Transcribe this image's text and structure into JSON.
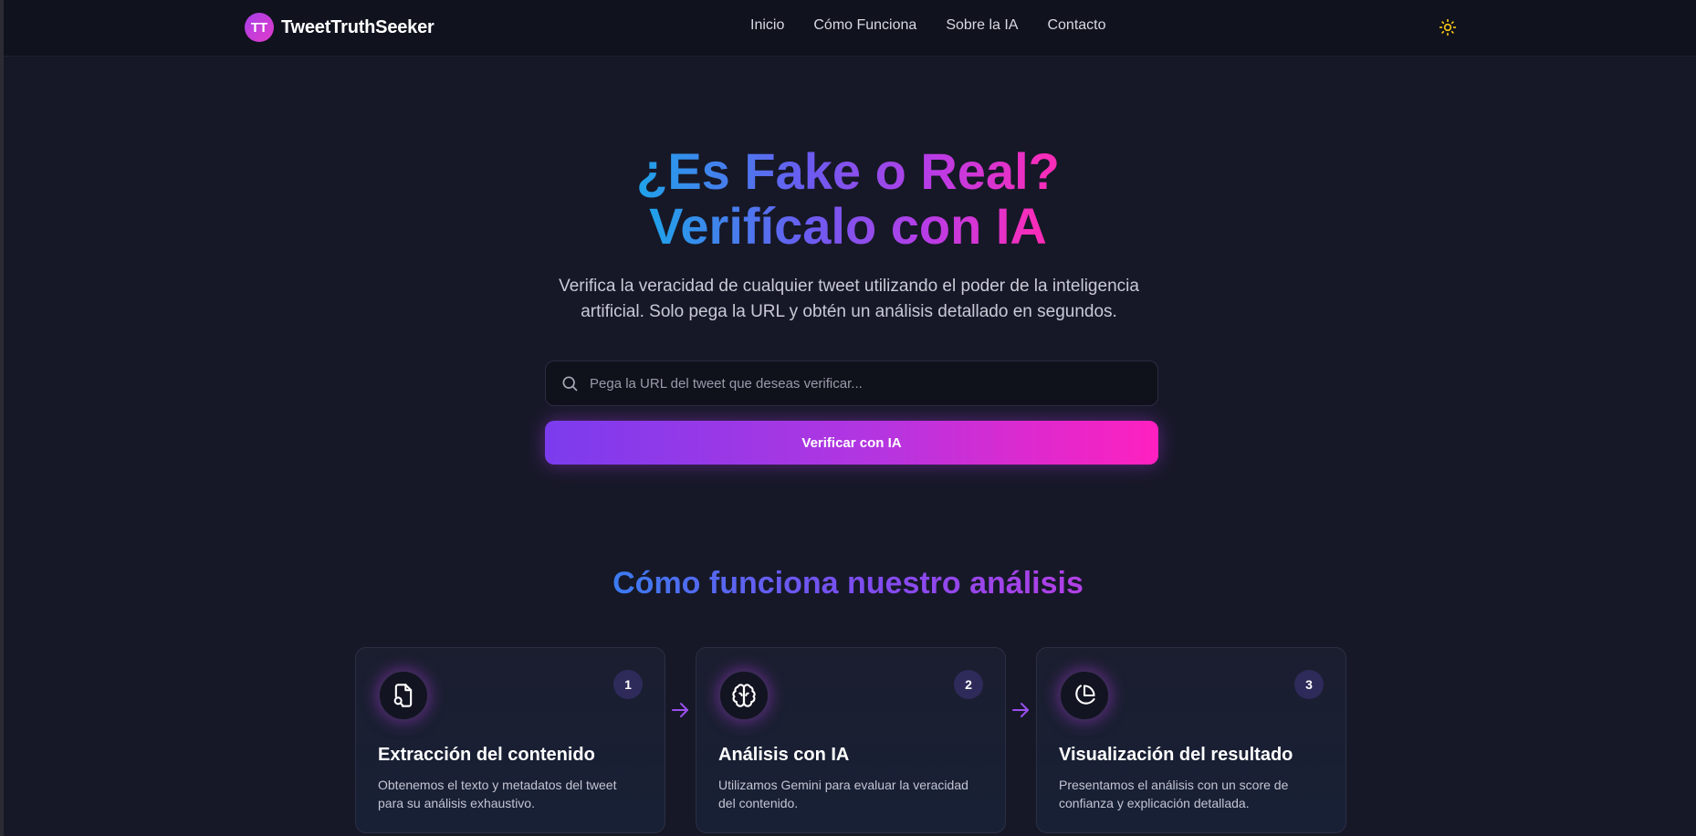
{
  "nav": {
    "logo_initials": "TT",
    "brand": "TweetTruthSeeker",
    "links": [
      "Inicio",
      "Cómo Funciona",
      "Sobre la IA",
      "Contacto"
    ],
    "theme_icon": "sun-icon"
  },
  "hero": {
    "title_line1": "¿Es Fake o Real?",
    "title_line2": "Verifícalo con IA",
    "subtitle": "Verifica la veracidad de cualquier tweet utilizando el poder de la inteligencia artificial. Solo pega la URL y obtén un análisis detallado en segundos.",
    "search_placeholder": "Pega la URL del tweet que deseas verificar...",
    "search_value": "",
    "button_label": "Verificar con IA"
  },
  "how": {
    "title": "Cómo funciona nuestro análisis",
    "steps": [
      {
        "number": "1",
        "icon": "file-search-icon",
        "title": "Extracción del contenido",
        "desc": "Obtenemos el texto y metadatos del tweet para su análisis exhaustivo."
      },
      {
        "number": "2",
        "icon": "brain-icon",
        "title": "Análisis con IA",
        "desc": "Utilizamos Gemini para evaluar la veracidad del contenido."
      },
      {
        "number": "3",
        "icon": "pie-chart-icon",
        "title": "Visualización del resultado",
        "desc": "Presentamos el análisis con un score de confianza y explicación detallada."
      }
    ]
  },
  "colors": {
    "background": "#161827",
    "navbar": "#10121d",
    "accent_purple": "#7b3cee",
    "accent_pink": "#ff20bf",
    "accent_blue": "#1fa3ea",
    "sun_yellow": "#f5c518"
  }
}
